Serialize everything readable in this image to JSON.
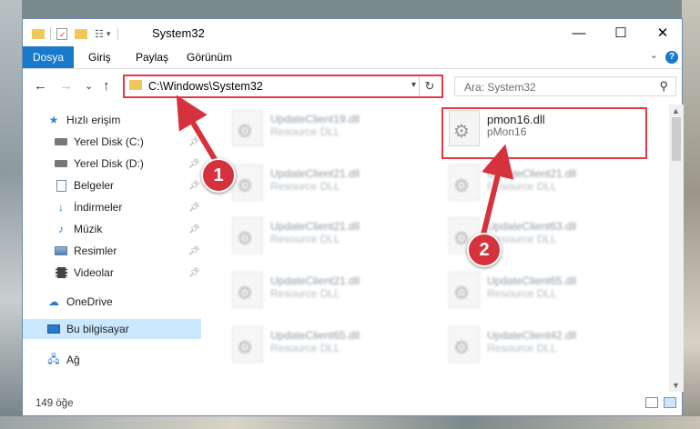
{
  "window": {
    "title": "System32",
    "minimize_glyph": "—",
    "maximize_glyph": "☐",
    "close_glyph": "✕"
  },
  "ribbon": {
    "tabs": [
      {
        "label": "Dosya"
      },
      {
        "label": "Giriş"
      },
      {
        "label": "Paylaş"
      },
      {
        "label": "Görünüm"
      }
    ],
    "help_label": "?"
  },
  "navigation": {
    "back": "←",
    "forward": "→",
    "recent": "⌄",
    "up": "↑",
    "address_path": "C:\\Windows\\System32",
    "refresh": "↻",
    "search_placeholder": "Ara: System32"
  },
  "sidebar": {
    "items": [
      {
        "label": "Hızlı erişim",
        "icon": "star-icon",
        "pinned": false,
        "color": "#3a86d1"
      },
      {
        "label": "Yerel Disk (C:)",
        "icon": "drive-icon",
        "pinned": true,
        "color": "#555555"
      },
      {
        "label": "Yerel Disk (D:)",
        "icon": "drive-icon",
        "pinned": true,
        "color": "#555555"
      },
      {
        "label": "Belgeler",
        "icon": "documents-icon",
        "pinned": true,
        "color": "#6f8fb5"
      },
      {
        "label": "İndirmeler",
        "icon": "download-icon",
        "pinned": true,
        "color": "#2a78c8"
      },
      {
        "label": "Müzik",
        "icon": "music-icon",
        "pinned": true,
        "color": "#2a78c8"
      },
      {
        "label": "Resimler",
        "icon": "pictures-icon",
        "pinned": true,
        "color": "#5a7fa8"
      },
      {
        "label": "Videolar",
        "icon": "videos-icon",
        "pinned": true,
        "color": "#444444"
      },
      {
        "label": "OneDrive",
        "icon": "cloud-icon",
        "pinned": false,
        "color": "#2a78c8"
      },
      {
        "label": "Bu bilgisayar",
        "icon": "computer-icon",
        "pinned": false,
        "selected": true,
        "color": "#2a78c8"
      },
      {
        "label": "Ağ",
        "icon": "network-icon",
        "pinned": false,
        "color": "#2a78c8"
      }
    ]
  },
  "files": [
    {
      "name": "UpdateClient19.dll",
      "desc": "Resource DLL"
    },
    {
      "name": "pmon16.dll",
      "desc": "pMon16"
    },
    {
      "name": "UpdateClient21.dll",
      "desc": "Resource DLL"
    },
    {
      "name": "UpdateClient21.dll",
      "desc": "Resource DLL"
    },
    {
      "name": "UpdateClient21.dll",
      "desc": "Resource DLL"
    },
    {
      "name": "UpdateClient63.dll",
      "desc": "Resource DLL"
    },
    {
      "name": "UpdateClient21.dll",
      "desc": "Resource DLL"
    },
    {
      "name": "UpdateClient65.dll",
      "desc": "Resource DLL"
    },
    {
      "name": "UpdateClient65.dll",
      "desc": "Resource DLL"
    },
    {
      "name": "UpdateClient42.dll",
      "desc": "Resource DLL"
    }
  ],
  "status": {
    "item_count": "149 öğe"
  },
  "annotations": {
    "step1": "1",
    "step2": "2",
    "color": "#d6323d"
  }
}
